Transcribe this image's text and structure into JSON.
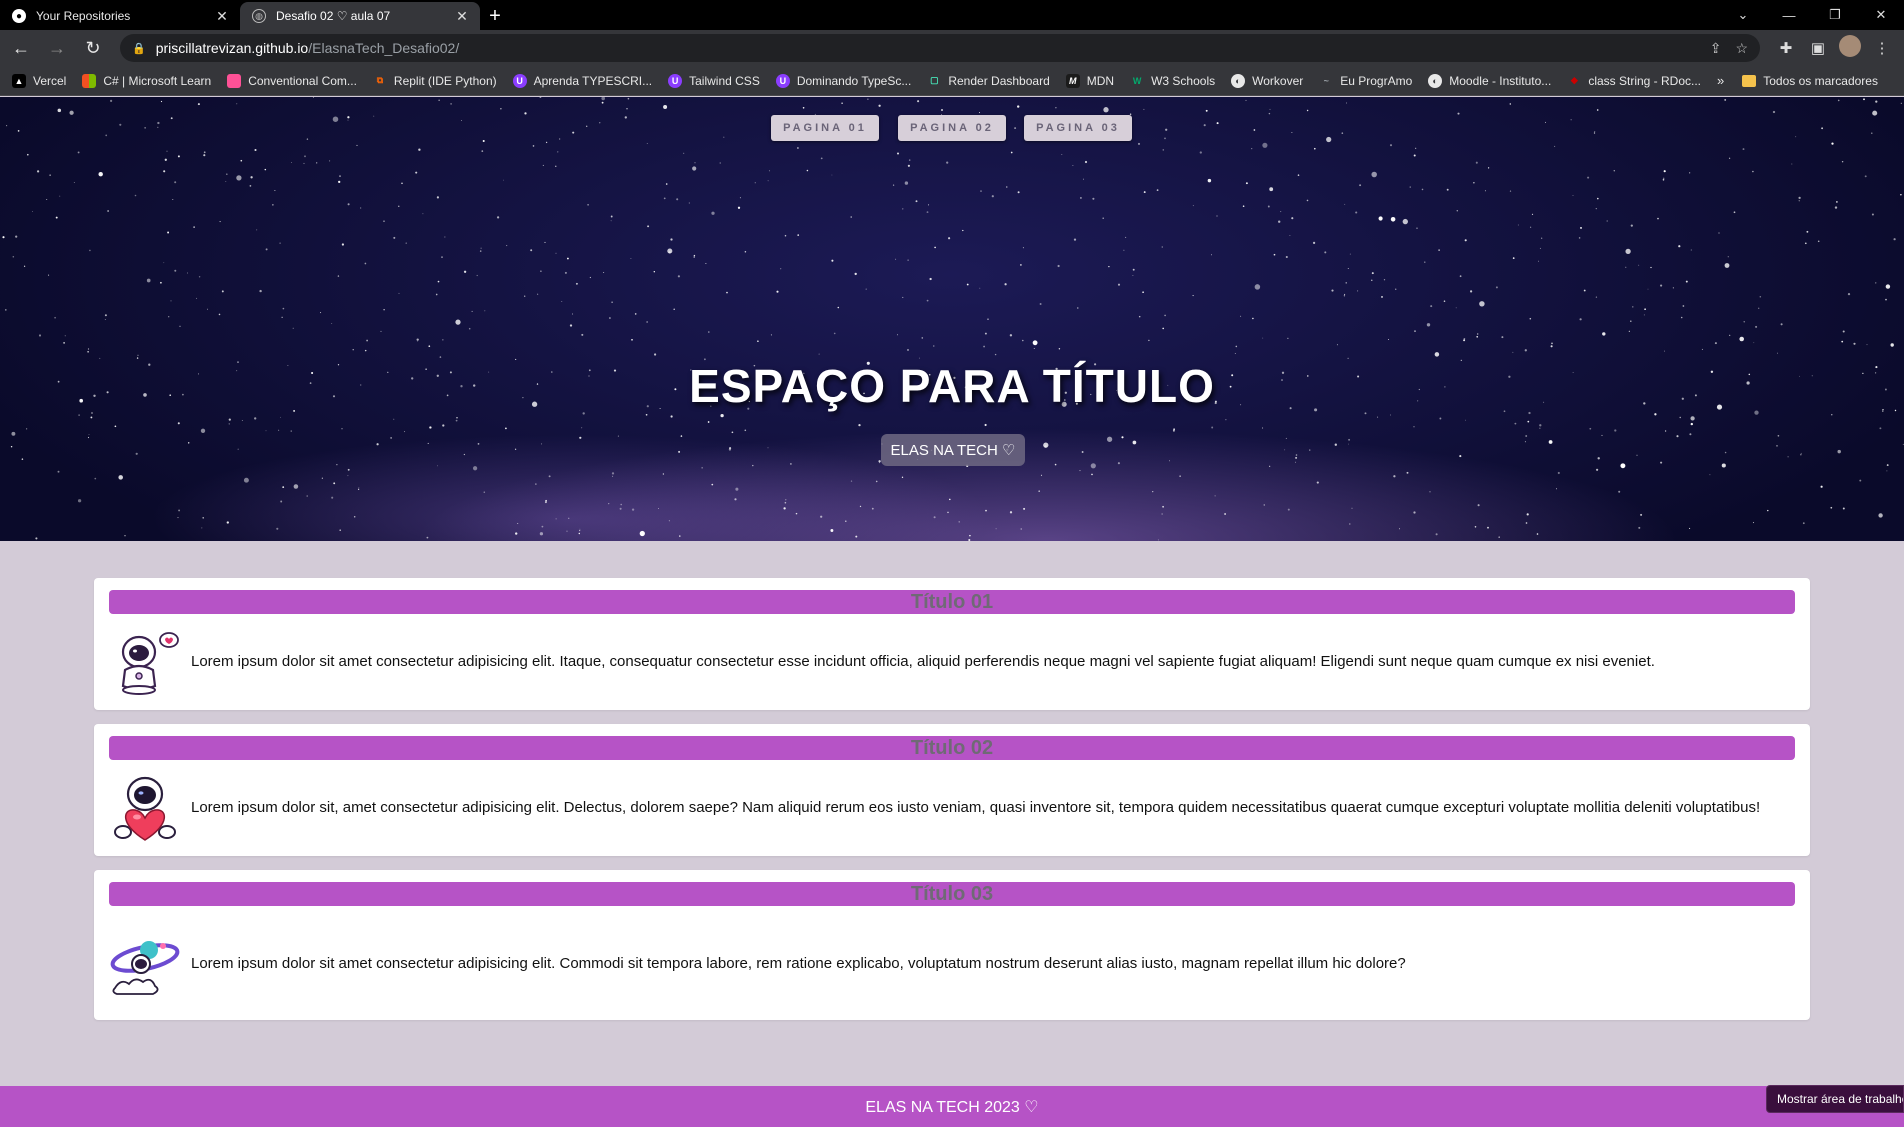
{
  "browser": {
    "tabs": [
      {
        "title": "Your Repositories",
        "active": false,
        "icon": "github-icon"
      },
      {
        "title": "Desafio 02 ♡ aula 07",
        "active": true,
        "icon": "globe-icon"
      }
    ],
    "new_tab_symbol": "+",
    "address": {
      "host": "priscillatrevizan.github.io",
      "path": "/ElasnaTech_Desafio02/"
    },
    "bookmarks": [
      {
        "label": "Vercel",
        "color": "#000000",
        "glyph": "▲"
      },
      {
        "label": "C# | Microsoft Learn",
        "color": "#f25022",
        "glyph": "■"
      },
      {
        "label": "Conventional Com...",
        "color": "#fe5196",
        "glyph": ""
      },
      {
        "label": "Replit (IDE Python)",
        "color": "#f26207",
        "glyph": "⧉"
      },
      {
        "label": "Aprenda TYPESCRI...",
        "color": "#8b3dff",
        "glyph": "U"
      },
      {
        "label": "Tailwind CSS",
        "color": "#8b3dff",
        "glyph": "U"
      },
      {
        "label": "Dominando TypeSc...",
        "color": "#8b3dff",
        "glyph": "U"
      },
      {
        "label": "Render Dashboard",
        "color": "#46e3b7",
        "glyph": "▢"
      },
      {
        "label": "MDN",
        "color": "#1b1b1b",
        "glyph": "M"
      },
      {
        "label": "W3 Schools",
        "color": "#04aa6d",
        "glyph": "W"
      },
      {
        "label": "Workover",
        "color": "#5f6368",
        "glyph": "◐"
      },
      {
        "label": "Eu ProgrAmo",
        "color": "#3c4043",
        "glyph": "~"
      },
      {
        "label": "Moodle - Instituto...",
        "color": "#5f6368",
        "glyph": "◐"
      },
      {
        "label": "class String - RDoc...",
        "color": "#cc0000",
        "glyph": "◆"
      }
    ],
    "bookmarks_more": "»",
    "bookmarks_folder": "Todos os marcadores"
  },
  "nav": {
    "pages": [
      "PAGINA 01",
      "PAGINA 02",
      "PAGINA 03"
    ]
  },
  "hero": {
    "title": "ESPAÇO PARA TÍTULO",
    "badge": "ELAS NA TECH ♡"
  },
  "cards": [
    {
      "title": "Título 01",
      "image": "astronaut-heart-bubble",
      "text": "Lorem ipsum dolor sit amet consectetur adipisicing elit. Itaque, consequatur consectetur esse incidunt officia, aliquid perferendis neque magni vel sapiente fugiat aliquam! Eligendi sunt neque quam cumque ex nisi eveniet."
    },
    {
      "title": "Título 02",
      "image": "astronaut-holding-heart",
      "text": "Lorem ipsum dolor sit, amet consectetur adipisicing elit. Delectus, dolorem saepe? Nam aliquid rerum eos iusto veniam, quasi inventore sit, tempora quidem necessitatibus quaerat cumque excepturi voluptate mollitia deleniti voluptatibus!"
    },
    {
      "title": "Título 03",
      "image": "astronaut-planet-cloud",
      "text": "Lorem ipsum dolor sit amet consectetur adipisicing elit. Commodi sit tempora labore, rem ratione explicabo, voluptatum nostrum deserunt alias iusto, magnam repellat illum hic dolore?"
    }
  ],
  "footer": {
    "text": "ELAS NA TECH 2023 ♡"
  },
  "tooltip": {
    "text": "Mostrar área de trabalho"
  },
  "colors": {
    "accent": "#b653c6",
    "page_bg": "#d3cbd7",
    "card_bg": "#ffffff"
  }
}
